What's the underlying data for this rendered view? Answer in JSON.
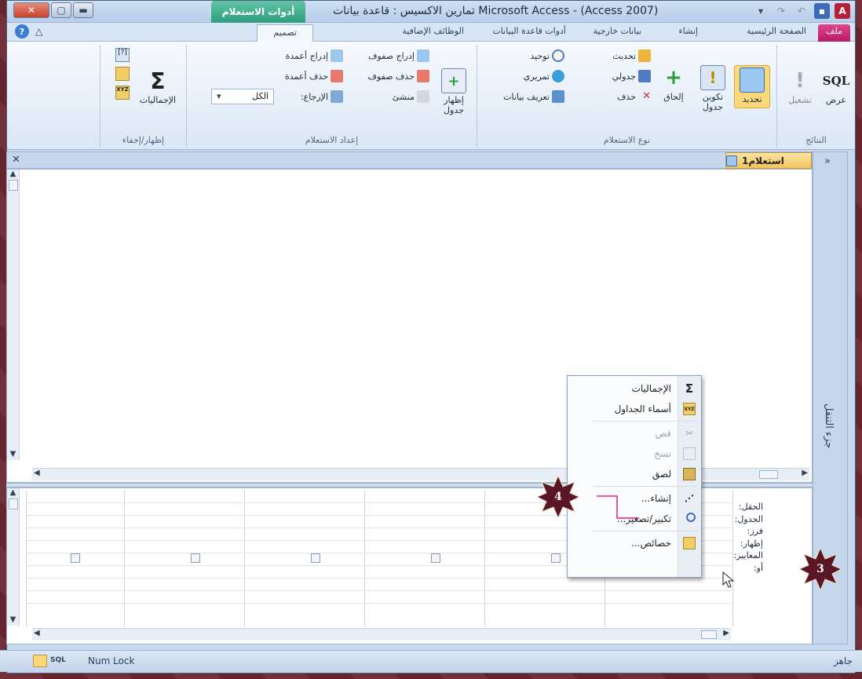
{
  "window": {
    "title": "Microsoft Access - (Access 2007) تمارين الاكسيس : قاعدة بيانات",
    "context_tab": "أدوات الاستعلام"
  },
  "tabs": [
    {
      "label": "ملف",
      "id": "file"
    },
    {
      "label": "الصفحة الرئيسية",
      "id": "home"
    },
    {
      "label": "إنشاء",
      "id": "create"
    },
    {
      "label": "بيانات خارجية",
      "id": "external"
    },
    {
      "label": "أدوات قاعدة البيانات",
      "id": "dbtools"
    },
    {
      "label": "الوظائف الإضافية",
      "id": "addins"
    },
    {
      "label": "تصميم",
      "id": "design"
    }
  ],
  "ribbon": {
    "results": {
      "label": "النتائج",
      "view": "عرض",
      "run": "تشغيل"
    },
    "query_type": {
      "label": "نوع الاستعلام",
      "select": "تحديد",
      "make_table": "تكوين جدول",
      "append": "إلحاق",
      "update": "تحديث",
      "crosstab": "جدولي",
      "delete": "حذف",
      "union": "توحيد",
      "pass_through": "تمريري",
      "data_definition": "تعريف بيانات"
    },
    "query_setup": {
      "label": "إعداد الاستعلام",
      "show_table": "إظهار جدول",
      "insert_rows": "إدراج صفوف",
      "delete_rows": "حذف صفوف",
      "builder": "منشئ",
      "insert_columns": "إدراج أعمدة",
      "delete_columns": "حذف أعمدة",
      "return": "الإرجاع:",
      "return_value": "الكل"
    },
    "show_hide": {
      "label": "إظهار/إخفاء",
      "totals": "الإجماليات"
    }
  },
  "document": {
    "tab_label": "استعلام1"
  },
  "nav_pane": {
    "label": "جزء التنقل"
  },
  "design_grid": {
    "row_labels": [
      "الحقل:",
      "الجدول:",
      "فرز:",
      "إظهار:",
      "المعايير:",
      "أو:"
    ]
  },
  "context_menu": {
    "items": [
      {
        "label": "الإجماليات",
        "icon": "sigma-icon",
        "disabled": false
      },
      {
        "label": "أسماء الجداول",
        "icon": "table-names-icon",
        "disabled": false
      },
      {
        "label": "قص",
        "icon": "scissors-icon",
        "disabled": true
      },
      {
        "label": "نسخ",
        "icon": "copy-icon",
        "disabled": true
      },
      {
        "label": "لصق",
        "icon": "paste-icon",
        "disabled": false
      },
      {
        "label": "إنشاء...",
        "icon": "build-wand-icon",
        "disabled": false
      },
      {
        "label": "تكبير/تصغير...",
        "icon": "zoom-icon",
        "disabled": false
      },
      {
        "label": "خصائص...",
        "icon": "properties-icon",
        "disabled": false
      }
    ]
  },
  "callouts": {
    "step3": "3",
    "step4": "4"
  },
  "status_bar": {
    "ready": "جاهز",
    "num_lock": "Num Lock",
    "sql": "SQL"
  },
  "colors": {
    "context_tab": "#2e9d7e",
    "file_tab": "#c2246f",
    "badge": "#5a1624",
    "accent_pink": "#e0207a"
  }
}
